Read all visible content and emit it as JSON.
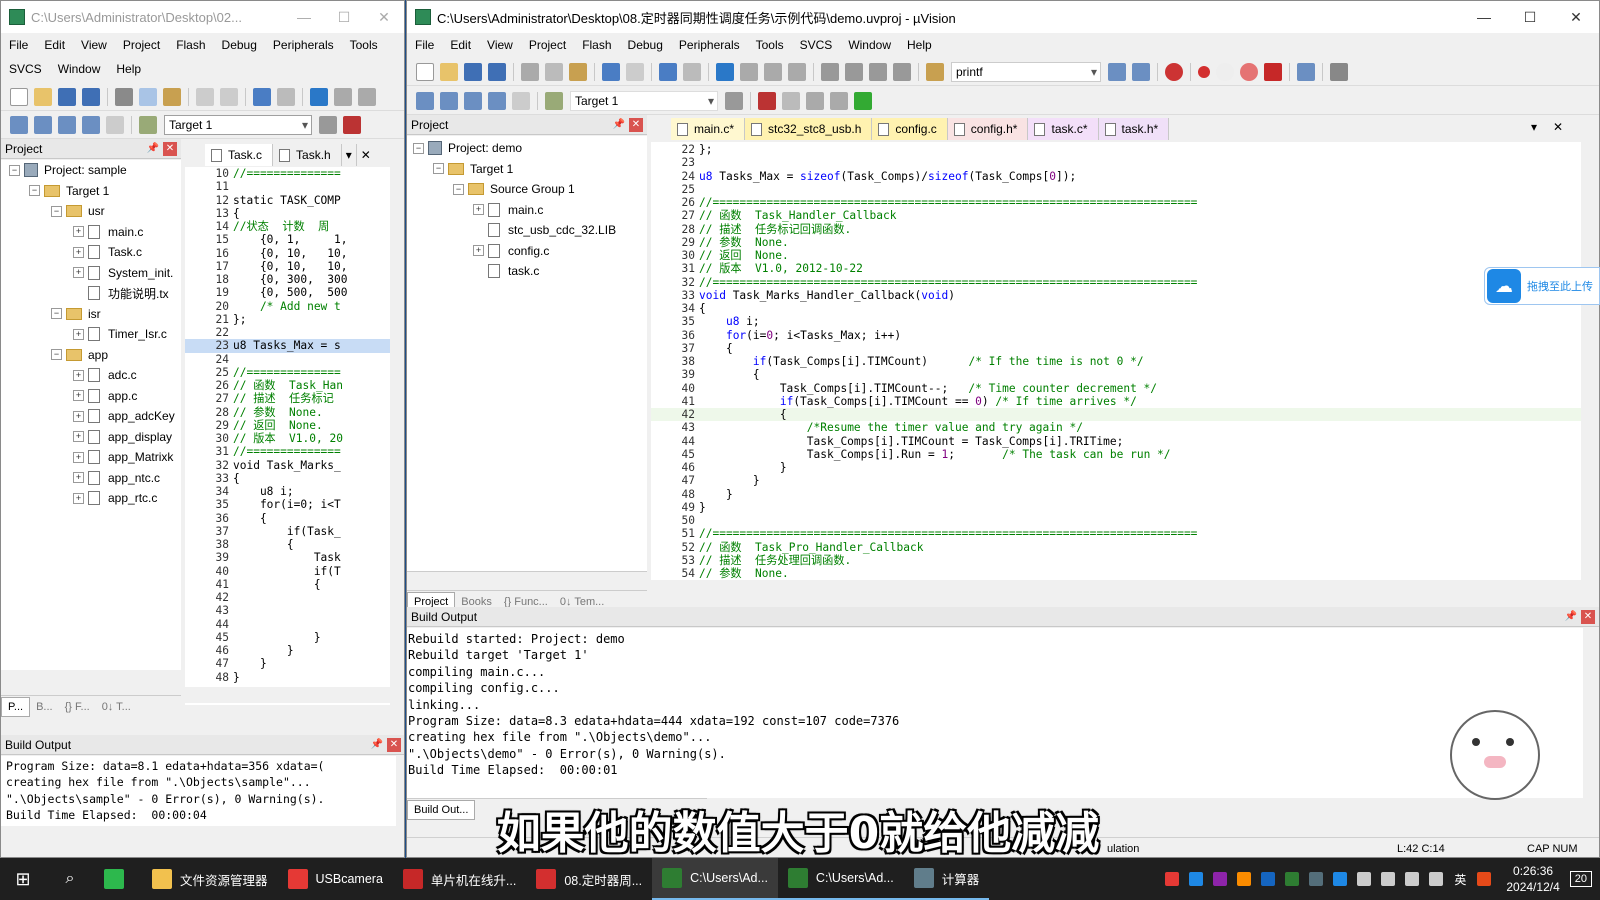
{
  "left_window": {
    "title": "C:\\Users\\Administrator\\Desktop\\02...",
    "menu": [
      "File",
      "Edit",
      "View",
      "Project",
      "Flash",
      "Debug",
      "Peripherals",
      "Tools"
    ],
    "menu2": [
      "SVCS",
      "Window",
      "Help"
    ],
    "target": "Target 1",
    "project_pane_title": "Project",
    "tree": {
      "root": "Project: sample",
      "target": "Target 1",
      "groups": [
        {
          "name": "usr",
          "files": [
            "main.c",
            "Task.c",
            "System_init.",
            "功能说明.tx"
          ]
        },
        {
          "name": "isr",
          "files": [
            "Timer_Isr.c"
          ]
        },
        {
          "name": "app",
          "files": [
            "adc.c",
            "app.c",
            "app_adcKey",
            "app_display",
            "app_Matrixk",
            "app_ntc.c",
            "app_rtc.c"
          ]
        }
      ]
    },
    "bottom_tabs": [
      "P...",
      "B...",
      "{} F...",
      "0↓ T..."
    ],
    "editor_tabs": [
      "Task.c",
      "Task.h"
    ],
    "code": [
      {
        "n": "10",
        "t": "//=============="
      },
      {
        "n": "11",
        "t": ""
      },
      {
        "n": "12",
        "t": "static TASK_COMP"
      },
      {
        "n": "13",
        "t": "{"
      },
      {
        "n": "14",
        "t": "//状态  计数  周"
      },
      {
        "n": "15",
        "t": "    {0, 1,     1,"
      },
      {
        "n": "16",
        "t": "    {0, 10,   10,"
      },
      {
        "n": "17",
        "t": "    {0, 10,   10,"
      },
      {
        "n": "18",
        "t": "    {0, 300,  300"
      },
      {
        "n": "19",
        "t": "    {0, 500,  500"
      },
      {
        "n": "20",
        "t": "    /* Add new t"
      },
      {
        "n": "21",
        "t": "};"
      },
      {
        "n": "22",
        "t": ""
      },
      {
        "n": "23",
        "t": "u8 Tasks_Max = s"
      },
      {
        "n": "24",
        "t": ""
      },
      {
        "n": "25",
        "t": "//=============="
      },
      {
        "n": "26",
        "t": "// 函数  Task_Han"
      },
      {
        "n": "27",
        "t": "// 描述  任务标记"
      },
      {
        "n": "28",
        "t": "// 参数  None."
      },
      {
        "n": "29",
        "t": "// 返回  None."
      },
      {
        "n": "30",
        "t": "// 版本  V1.0, 20"
      },
      {
        "n": "31",
        "t": "//=============="
      },
      {
        "n": "32",
        "t": "void Task_Marks_"
      },
      {
        "n": "33",
        "t": "{"
      },
      {
        "n": "34",
        "t": "    u8 i;"
      },
      {
        "n": "35",
        "t": "    for(i=0; i<T"
      },
      {
        "n": "36",
        "t": "    {"
      },
      {
        "n": "37",
        "t": "        if(Task_"
      },
      {
        "n": "38",
        "t": "        {"
      },
      {
        "n": "39",
        "t": "            Task"
      },
      {
        "n": "40",
        "t": "            if(T"
      },
      {
        "n": "41",
        "t": "            {"
      },
      {
        "n": "42",
        "t": ""
      },
      {
        "n": "43",
        "t": ""
      },
      {
        "n": "44",
        "t": ""
      },
      {
        "n": "45",
        "t": "            }"
      },
      {
        "n": "46",
        "t": "        }"
      },
      {
        "n": "47",
        "t": "    }"
      },
      {
        "n": "48",
        "t": "}"
      }
    ],
    "build_title": "Build Output",
    "build": [
      "Program Size: data=8.1 edata+hdata=356 xdata=(",
      "creating hex file from \".\\Objects\\sample\"...",
      "\".\\Objects\\sample\" - 0 Error(s), 0 Warning(s).",
      "Build Time Elapsed:  00:00:04"
    ]
  },
  "main_window": {
    "title": "C:\\Users\\Administrator\\Desktop\\08.定时器同期性调度任务\\示例代码\\demo.uvproj - µVision",
    "menu": [
      "File",
      "Edit",
      "View",
      "Project",
      "Flash",
      "Debug",
      "Peripherals",
      "Tools",
      "SVCS",
      "Window",
      "Help"
    ],
    "find_combo": "printf",
    "target": "Target 1",
    "project_pane_title": "Project",
    "tree": {
      "root": "Project: demo",
      "target": "Target 1",
      "group": "Source Group 1",
      "files": [
        "main.c",
        "stc_usb_cdc_32.LIB",
        "config.c",
        "task.c"
      ]
    },
    "bottom_tabs": [
      "Project",
      "Books",
      "{} Func...",
      "0↓ Tem..."
    ],
    "editor_tabs": [
      "main.c*",
      "stc32_stc8_usb.h",
      "config.c",
      "config.h*",
      "task.c*",
      "task.h*"
    ],
    "active_tab_index": 4,
    "code": [
      {
        "n": "22",
        "t": "};"
      },
      {
        "n": "23",
        "t": ""
      },
      {
        "n": "24",
        "t": "u8 Tasks_Max = sizeof(Task_Comps)/sizeof(Task_Comps[0]);"
      },
      {
        "n": "25",
        "t": ""
      },
      {
        "n": "26",
        "t": "//========================================================================"
      },
      {
        "n": "27",
        "t": "// 函数  Task_Handler_Callback"
      },
      {
        "n": "28",
        "t": "// 描述  任务标记回调函数."
      },
      {
        "n": "29",
        "t": "// 参数  None."
      },
      {
        "n": "30",
        "t": "// 返回  None."
      },
      {
        "n": "31",
        "t": "// 版本  V1.0, 2012-10-22"
      },
      {
        "n": "32",
        "t": "//========================================================================"
      },
      {
        "n": "33",
        "t": "void Task_Marks_Handler_Callback(void)"
      },
      {
        "n": "34",
        "t": "{"
      },
      {
        "n": "35",
        "t": "    u8 i;"
      },
      {
        "n": "36",
        "t": "    for(i=0; i<Tasks_Max; i++)"
      },
      {
        "n": "37",
        "t": "    {"
      },
      {
        "n": "38",
        "t": "        if(Task_Comps[i].TIMCount)      /* If the time is not 0 */"
      },
      {
        "n": "39",
        "t": "        {"
      },
      {
        "n": "40",
        "t": "            Task_Comps[i].TIMCount--;   /* Time counter decrement */"
      },
      {
        "n": "41",
        "t": "            if(Task_Comps[i].TIMCount == 0) /* If time arrives */"
      },
      {
        "n": "42",
        "t": "            {"
      },
      {
        "n": "43",
        "t": "                /*Resume the timer value and try again */"
      },
      {
        "n": "44",
        "t": "                Task_Comps[i].TIMCount = Task_Comps[i].TRITime;"
      },
      {
        "n": "45",
        "t": "                Task_Comps[i].Run = 1;       /* The task can be run */"
      },
      {
        "n": "46",
        "t": "            }"
      },
      {
        "n": "47",
        "t": "        }"
      },
      {
        "n": "48",
        "t": "    }"
      },
      {
        "n": "49",
        "t": "}"
      },
      {
        "n": "50",
        "t": ""
      },
      {
        "n": "51",
        "t": "//========================================================================"
      },
      {
        "n": "52",
        "t": "// 函数  Task_Pro_Handler_Callback"
      },
      {
        "n": "53",
        "t": "// 描述  任务处理回调函数."
      },
      {
        "n": "54",
        "t": "// 参数  None."
      }
    ],
    "build_title": "Build Output",
    "build": [
      "Rebuild started: Project: demo",
      "Rebuild target 'Target 1'",
      "compiling main.c...",
      "compiling config.c...",
      "linking...",
      "Program Size: data=8.3 edata+hdata=444 xdata=192 const=107 code=7376",
      "creating hex file from \".\\Objects\\demo\"...",
      "\".\\Objects\\demo\" - 0 Error(s), 0 Warning(s).",
      "Build Time Elapsed:  00:00:01"
    ],
    "build_tab": "Build Out...",
    "status_mid": "ulation",
    "status_pos": "L:42 C:14",
    "status_caps": "CAP  NUM"
  },
  "side_widget": {
    "text": "拖拽至此上传"
  },
  "subtitle": "如果他的数值大于0就给他减减",
  "taskbar": {
    "items": [
      {
        "label": "",
        "color": "#2db84d"
      },
      {
        "label": "文件资源管理器",
        "color": "#f2c14e"
      },
      {
        "label": "USBcamera",
        "color": "#e53935"
      },
      {
        "label": "单片机在线升...",
        "color": "#c62828"
      },
      {
        "label": "08.定时器周...",
        "color": "#d32f2f"
      },
      {
        "label": "C:\\Users\\Ad...",
        "color": "#2e7d32"
      },
      {
        "label": "C:\\Users\\Ad...",
        "color": "#2e7d32"
      },
      {
        "label": "计算器",
        "color": "#607d8b"
      }
    ],
    "ime": "英",
    "time": "0:26:36",
    "date": "2024/12/4",
    "notif": "20"
  },
  "colors": {
    "accent": "#0078d7",
    "keyword": "#0000ff",
    "comment": "#008000",
    "number": "#800080"
  }
}
